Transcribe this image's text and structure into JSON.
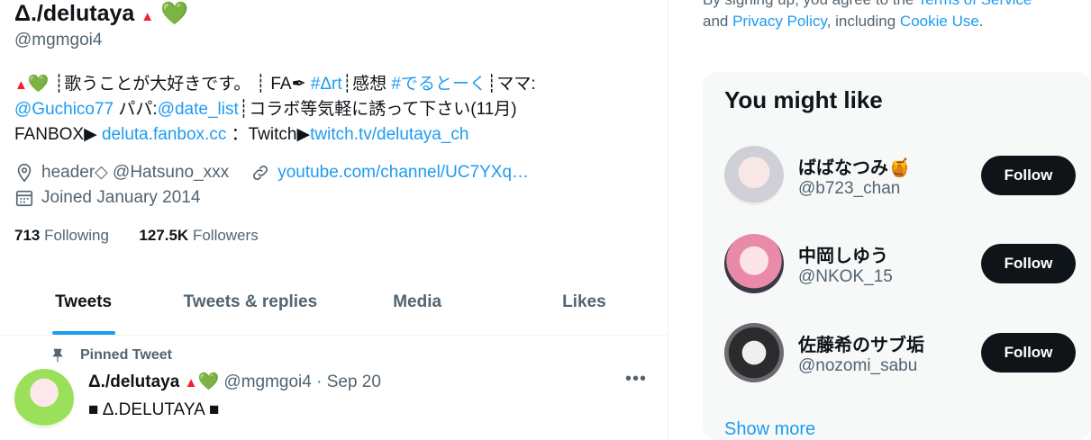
{
  "profile": {
    "name": "Δ./delutaya",
    "name_badge_tri": "▲",
    "name_badge_heart": "💚",
    "handle": "@mgmgoi4",
    "bio": {
      "l1_a": "▲",
      "l1_b": "💚",
      "l1_c": " ┊歌うことが大好きです。 ┊ FA",
      "l1_pen": "✒",
      "l1_tag1": "#Δrt",
      "l1_d": "┊感想 ",
      "l1_tag2": "#でるとーく",
      "l1_e": "┊ママ:",
      "l2_mention1": "@Guchico77",
      "l2_a": " パパ:",
      "l2_mention2": "@date_list",
      "l2_b": "┊コラボ等気軽に誘って下さい(11月)",
      "l3_a": "FANBOX▶ ",
      "l3_link1": "deluta.fanbox.cc",
      "l3_b": " ：Twitch▶",
      "l3_link2": "twitch.tv/delutaya_ch"
    },
    "location": "header◇ @Hatsuno_xxx",
    "website": "youtube.com/channel/UC7YXq…",
    "joined": "Joined January 2014",
    "following_count": "713",
    "following_label": "Following",
    "followers_count": "127.5K",
    "followers_label": "Followers"
  },
  "tabs": [
    "Tweets",
    "Tweets & replies",
    "Media",
    "Likes"
  ],
  "pinned_tweet": {
    "label": "Pinned Tweet",
    "author": "Δ./delutaya",
    "tri": "▲",
    "heart": "💚",
    "meta": " @mgmgoi4 · Sep 20",
    "more": "•••",
    "text": "■ Δ.DELUTAYA ■"
  },
  "sidebar": {
    "terms_text_1": "By signing up, you agree to the ",
    "terms_link": "Terms of Service",
    "terms_text_2": "and ",
    "privacy_link": "Privacy Policy",
    "terms_text_3": ", including ",
    "cookie_link": "Cookie Use",
    "terms_text_4": ".",
    "title": "You might like",
    "suggestions": [
      {
        "name": "ばばなつみ🍯",
        "handle": "@b723_chan",
        "button": "Follow"
      },
      {
        "name": "中岡しゆう",
        "handle": "@NKOK_15",
        "button": "Follow"
      },
      {
        "name": "佐藤希のサブ垢",
        "handle": "@nozomi_sabu",
        "button": "Follow"
      }
    ],
    "show_more": "Show more"
  },
  "colors": {
    "accent": "#1d9bf0",
    "text": "#0f1419",
    "muted": "#536471",
    "button": "#0f1419"
  }
}
